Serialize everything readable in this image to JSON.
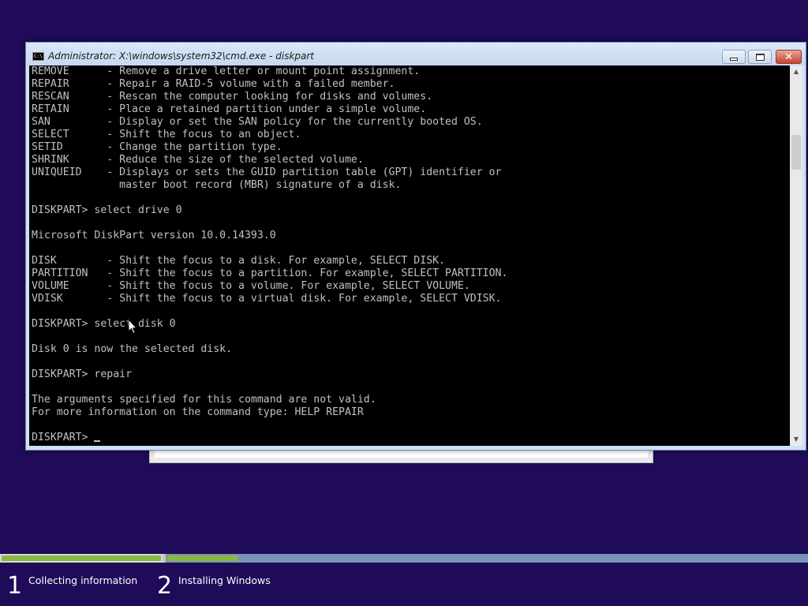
{
  "window": {
    "title": "Administrator: X:\\windows\\system32\\cmd.exe - diskpart",
    "icon": "cmd-icon",
    "icon_text": "C:\\"
  },
  "console": {
    "lines": [
      "REMOVE      - Remove a drive letter or mount point assignment.",
      "REPAIR      - Repair a RAID-5 volume with a failed member.",
      "RESCAN      - Rescan the computer looking for disks and volumes.",
      "RETAIN      - Place a retained partition under a simple volume.",
      "SAN         - Display or set the SAN policy for the currently booted OS.",
      "SELECT      - Shift the focus to an object.",
      "SETID       - Change the partition type.",
      "SHRINK      - Reduce the size of the selected volume.",
      "UNIQUEID    - Displays or sets the GUID partition table (GPT) identifier or",
      "              master boot record (MBR) signature of a disk.",
      "",
      "DISKPART> select drive 0",
      "",
      "Microsoft DiskPart version 10.0.14393.0",
      "",
      "DISK        - Shift the focus to a disk. For example, SELECT DISK.",
      "PARTITION   - Shift the focus to a partition. For example, SELECT PARTITION.",
      "VOLUME      - Shift the focus to a volume. For example, SELECT VOLUME.",
      "VDISK       - Shift the focus to a virtual disk. For example, SELECT VDISK.",
      "",
      "DISKPART> select disk 0",
      "",
      "Disk 0 is now the selected disk.",
      "",
      "DISKPART> repair",
      "",
      "The arguments specified for this command are not valid.",
      "For more information on the command type: HELP REPAIR",
      ""
    ],
    "prompt": "DISKPART> ",
    "text_color": "#c0c0c0",
    "background": "#000000"
  },
  "setup": {
    "background": "#1f0b57",
    "accent": "#8ab83e",
    "progress": [
      {
        "fraction": 1.0
      },
      {
        "fraction": 0.11
      }
    ],
    "steps": [
      {
        "number": "1",
        "label": "Collecting information"
      },
      {
        "number": "2",
        "label": "Installing Windows"
      }
    ]
  }
}
